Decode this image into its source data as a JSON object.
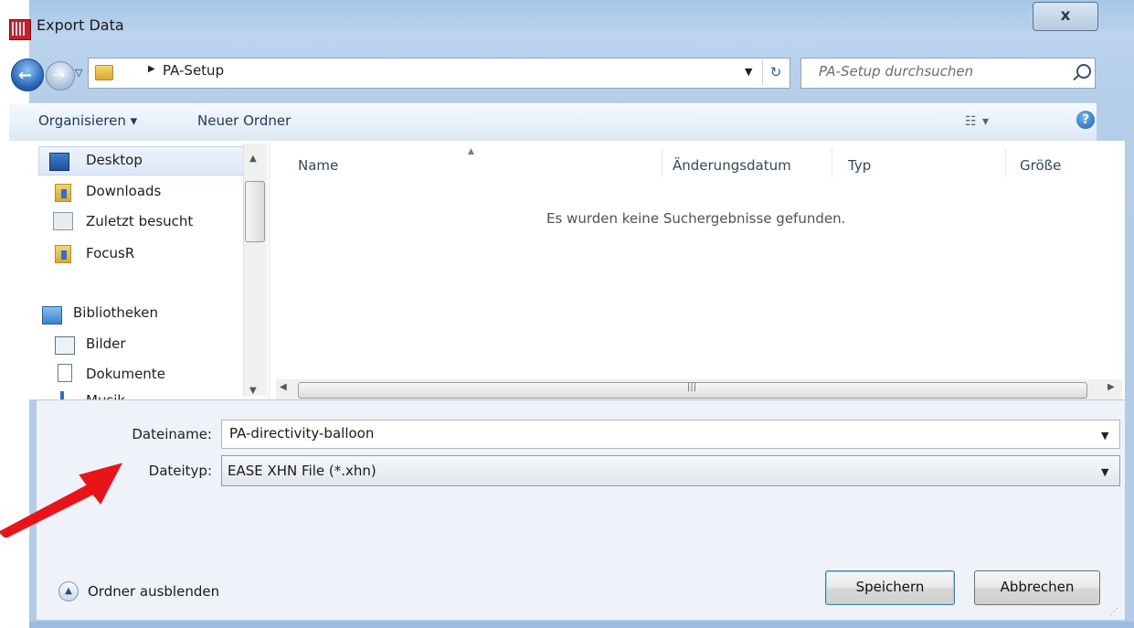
{
  "window": {
    "title": "Export Data",
    "close_label": "x"
  },
  "address_bar": {
    "path_segment": "PA-Setup",
    "search_placeholder": "PA-Setup durchsuchen"
  },
  "toolbar": {
    "organize": "Organisieren ▾",
    "new_folder": "Neuer Ordner"
  },
  "nav": {
    "items": [
      {
        "label": "Desktop",
        "icon": "desktop-icon"
      },
      {
        "label": "Downloads",
        "icon": "downloads-folder-icon"
      },
      {
        "label": "Zuletzt besucht",
        "icon": "recent-places-icon"
      },
      {
        "label": "FocusR",
        "icon": "folder-icon"
      },
      {
        "label": "Bibliotheken",
        "icon": "libraries-icon"
      },
      {
        "label": "Bilder",
        "icon": "pictures-icon"
      },
      {
        "label": "Dokumente",
        "icon": "documents-icon"
      },
      {
        "label": "Musik",
        "icon": "music-icon"
      }
    ]
  },
  "file_list": {
    "columns": [
      "Name",
      "Änderungsdatum",
      "Typ",
      "Größe"
    ],
    "empty_message": "Es wurden keine Suchergebnisse gefunden."
  },
  "form": {
    "filename_label": "Dateiname:",
    "filename_value": "PA-directivity-balloon",
    "filetype_label": "Dateityp:",
    "filetype_value": "EASE XHN File (*.xhn)"
  },
  "footer": {
    "hide_folders": "Ordner ausblenden",
    "save": "Speichern",
    "cancel": "Abbrechen"
  },
  "colors": {
    "window_frame": "#b4cde9",
    "annotation_arrow": "#e8141a"
  }
}
